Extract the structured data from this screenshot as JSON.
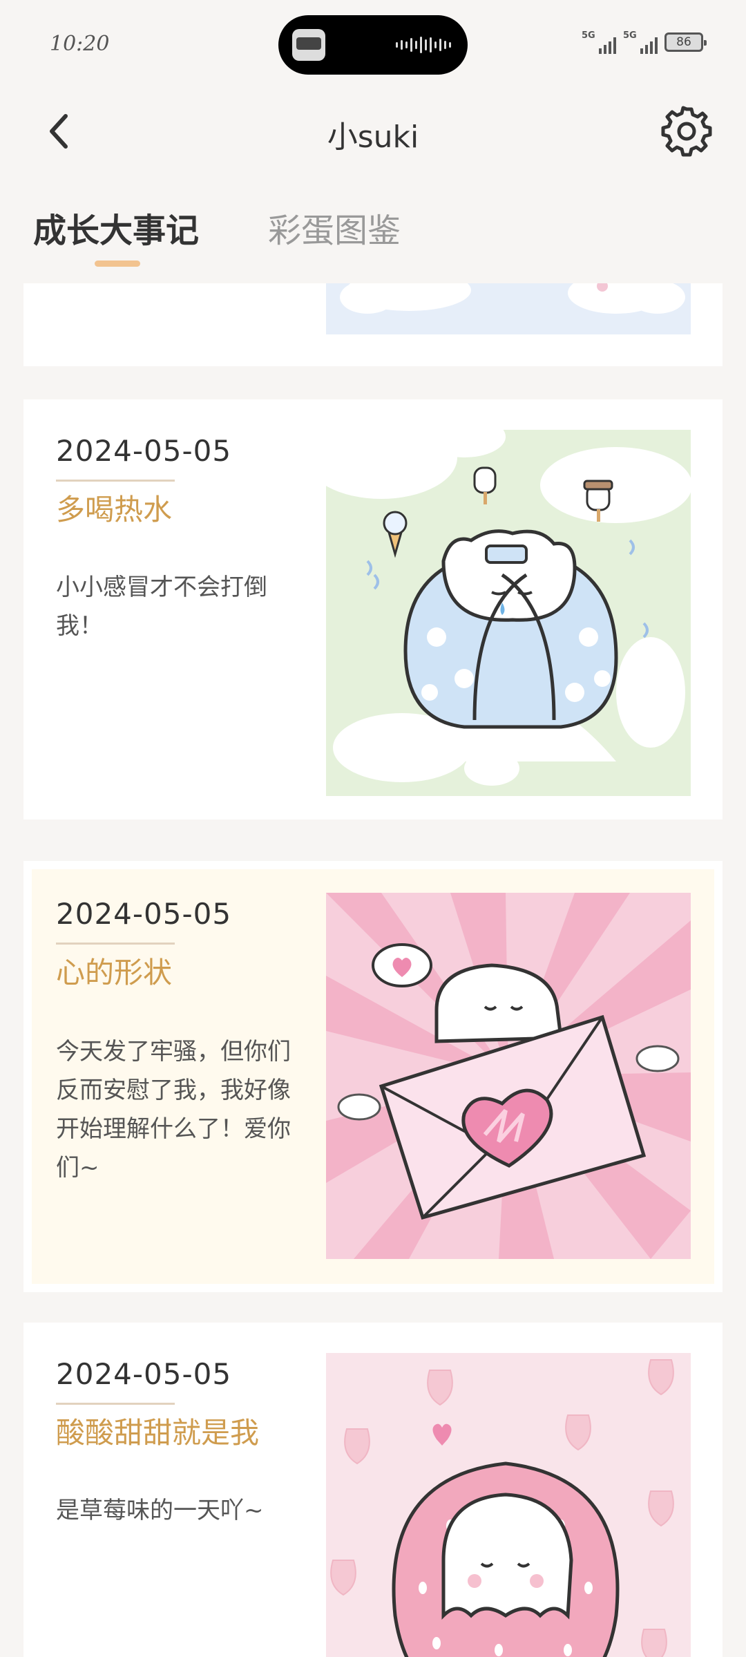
{
  "status_bar": {
    "time": "10:20",
    "signal_1": "5G",
    "signal_2": "5G",
    "battery": "86"
  },
  "header": {
    "title": "小suki"
  },
  "tabs": [
    {
      "label": "成长大事记",
      "active": true
    },
    {
      "label": "彩蛋图鉴",
      "active": false
    }
  ],
  "milestones": [
    {
      "date": "2024-05-05",
      "title": "多喝热水",
      "description": "小小感冒才不会打倒我！",
      "illustration": "cat-wrapped-in-blanket-sick"
    },
    {
      "date": "2024-05-05",
      "title": "心的形状",
      "description": "今天发了牢骚，但你们反而安慰了我，我好像开始理解什么了！爱你们~",
      "illustration": "cat-holding-heart-envelope"
    },
    {
      "date": "2024-05-05",
      "title": "酸酸甜甜就是我",
      "description": "是草莓味的一天吖~",
      "illustration": "cat-in-strawberry"
    }
  ],
  "colors": {
    "background": "#f7f5f3",
    "accent_title": "#cf9c4e",
    "tab_indicator": "#f2c38f",
    "highlight_card": "#fffaee"
  }
}
